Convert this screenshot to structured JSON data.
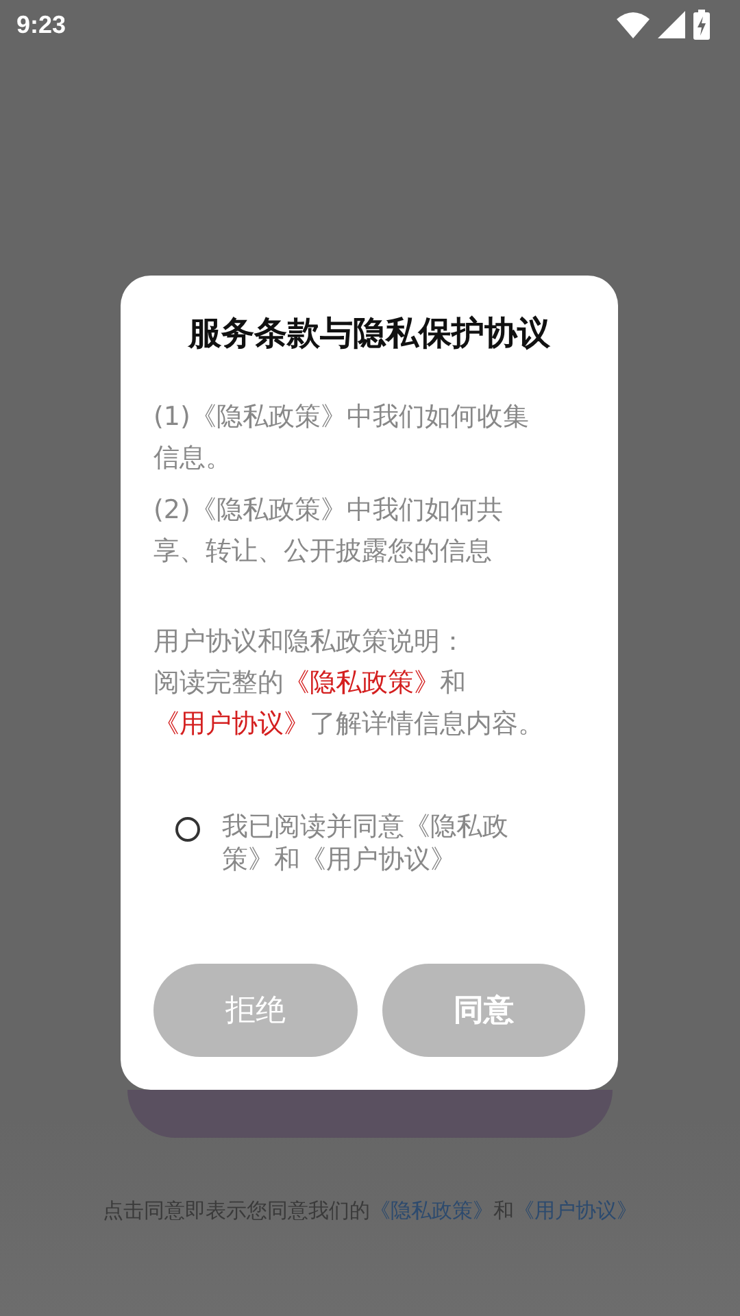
{
  "status_bar": {
    "time": "9:23"
  },
  "footer": {
    "segments": [
      {
        "text": "点击同意即表示您同意我们的",
        "link": false
      },
      {
        "text": "《隐私政策》",
        "link": true
      },
      {
        "text": "和",
        "link": false
      },
      {
        "text": "《用户协议》",
        "link": true
      }
    ]
  },
  "dialog": {
    "title": "服务条款与隐私保护协议",
    "paragraphs": [
      {
        "segments": [
          {
            "text": "(1)《隐私政策》中我们如何收集信息。",
            "link": false
          }
        ]
      },
      {
        "segments": [
          {
            "text": "(2)《隐私政策》中我们如何共享、转让、公开披露您的信息",
            "link": false
          }
        ]
      },
      {
        "segments": [
          {
            "text": "用户协议和隐私政策说明：",
            "link": false
          }
        ]
      },
      {
        "segments": [
          {
            "text": "阅读完整的",
            "link": false
          },
          {
            "text": "《隐私政策》",
            "link": true
          },
          {
            "text": "和",
            "link": false
          },
          {
            "text": "《用户协议》",
            "link": true
          },
          {
            "text": "了解详情信息内容。",
            "link": false
          }
        ]
      }
    ],
    "consent": {
      "label": "我已阅读并同意《隐私政策》和《用户协议》",
      "checked": false
    },
    "buttons": [
      {
        "label": "拒绝",
        "kind": "decline"
      },
      {
        "label": "同意",
        "kind": "accept"
      }
    ]
  }
}
